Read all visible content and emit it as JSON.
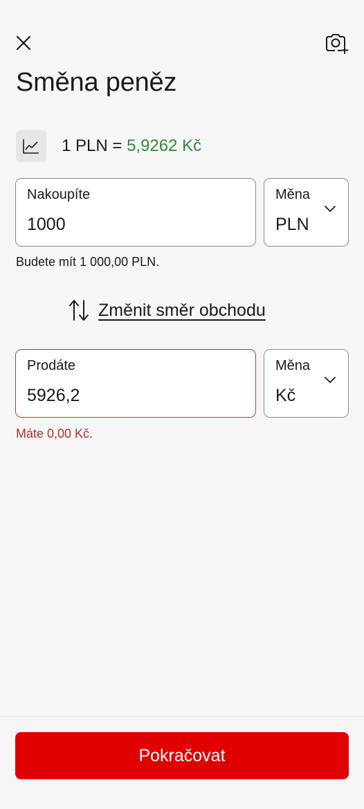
{
  "header": {
    "close_icon": "close-icon",
    "scan_icon": "camera-scan-icon",
    "title": "Směna peněz"
  },
  "rate": {
    "chart_icon": "line-chart-icon",
    "base": "1 PLN = ",
    "value": "5,9262 Kč",
    "value_color": "#2e8b3a"
  },
  "buy": {
    "label": "Nakoupíte",
    "value": "1000",
    "currency_label": "Měna",
    "currency": "PLN",
    "helper": "Budete mít 1 000,00 PLN."
  },
  "swap": {
    "icon": "swap-vertical-icon",
    "label": "Změnit směr obchodu"
  },
  "sell": {
    "label": "Prodáte",
    "value": "5926,2",
    "currency_label": "Měna",
    "currency": "Kč",
    "helper": "Máte 0,00 Kč.",
    "error_color": "#b0302a"
  },
  "footer": {
    "continue_label": "Pokračovat",
    "button_color": "#e10000"
  }
}
